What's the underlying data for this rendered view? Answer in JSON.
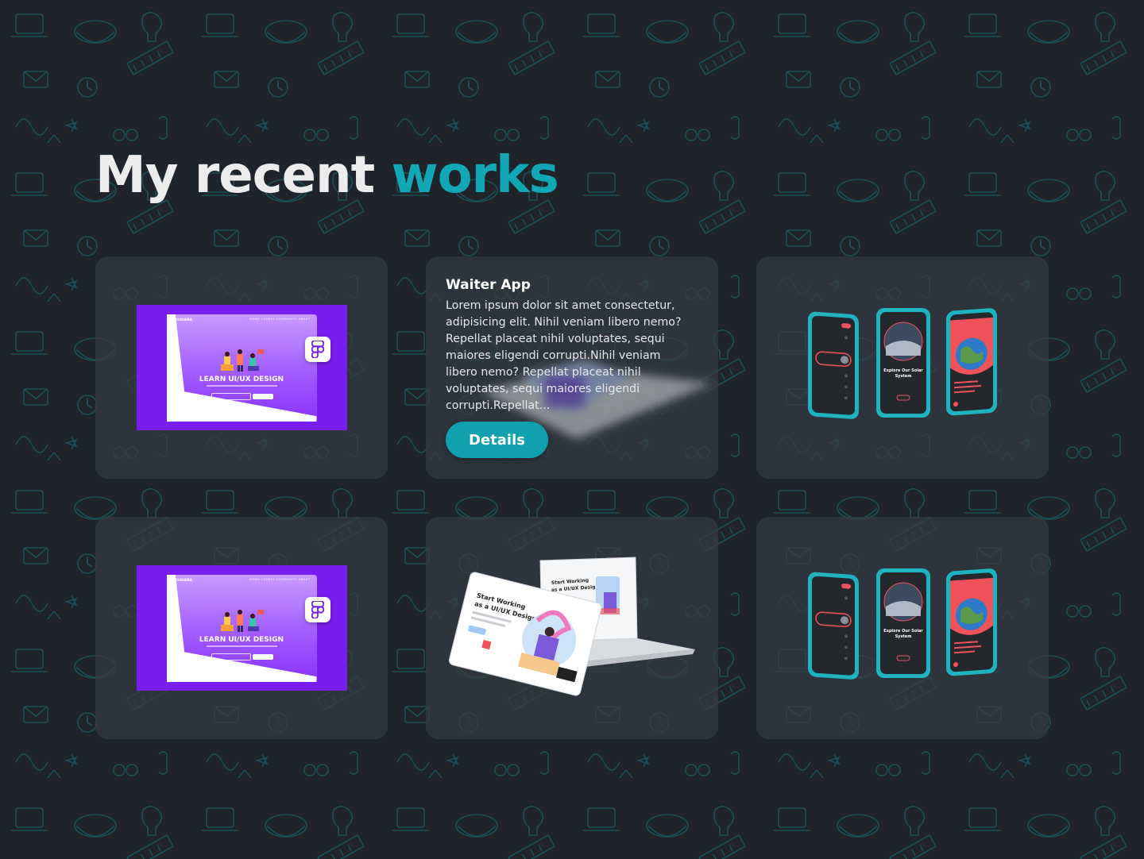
{
  "heading": {
    "part1": "My recent",
    "part2": "works"
  },
  "colors": {
    "background": "#1f242b",
    "accent": "#11a7b4",
    "card": "#343a42",
    "button": "#11a0ad",
    "purple": "#7a1df0",
    "phone_teal": "#1fb3bf",
    "phone_red": "#f0525b"
  },
  "projects": [
    {
      "thumbnail": "learn-ui-ux-landing",
      "mock_headline": "LEARN UI/UX DESIGN",
      "icon": "figma-icon"
    },
    {
      "title": "Waiter App",
      "description": "Lorem ipsum dolor sit amet consectetur, adipisicing elit. Nihil veniam libero nemo? Repellat placeat nihil voluptates, sequi maiores eligendi corrupti.Nihil veniam libero nemo? Repellat placeat nihil voluptates, sequi maiores eligendi corrupti.Repellat...",
      "button_label": "Details",
      "state": "hovered"
    },
    {
      "thumbnail": "solar-system-app",
      "phone_title": "Explore Our Solar System"
    },
    {
      "thumbnail": "learn-ui-ux-landing",
      "mock_headline": "LEARN UI/UX DESIGN",
      "icon": "figma-icon"
    },
    {
      "thumbnail": "start-working-laptop",
      "mock_headline": "Start Working as a UI/UX Designer"
    },
    {
      "thumbnail": "solar-system-app",
      "phone_title": "Explore Our Solar System"
    }
  ]
}
